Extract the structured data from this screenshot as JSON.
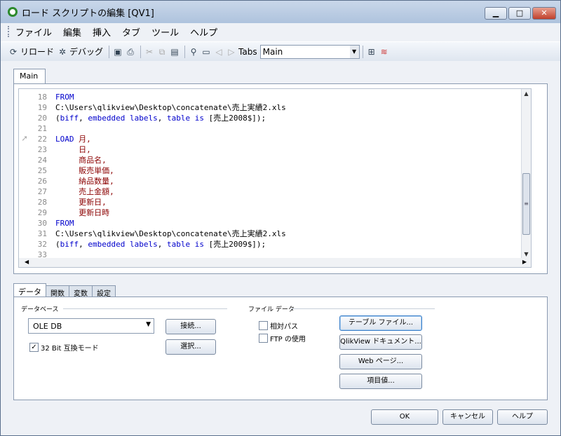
{
  "window": {
    "title": "ロード スクリプトの編集 [QV1]",
    "minimize": "▁",
    "maximize": "□",
    "close": "✕"
  },
  "menu": [
    "ファイル",
    "編集",
    "挿入",
    "タブ",
    "ツール",
    "ヘルプ"
  ],
  "toolbar": {
    "reload_label": "リロード",
    "debug_label": "デバッグ",
    "tabs_label": "Tabs",
    "tabs_selected": "Main",
    "icons": [
      "save-icon",
      "print-icon",
      "cut-icon",
      "copy-icon",
      "paste-icon",
      "search-icon",
      "folder-icon",
      "tab-left-icon",
      "tab-right-icon",
      "hierarchy-icon",
      "spellcheck-icon"
    ]
  },
  "editor": {
    "tab_label": "Main",
    "lines": [
      {
        "n": "18",
        "parts": [
          {
            "t": "FROM",
            "c": "kw"
          }
        ]
      },
      {
        "n": "19",
        "parts": [
          {
            "t": "C:\\Users\\qlikview\\Desktop\\concatenate\\売上実績2.xls",
            "c": ""
          }
        ]
      },
      {
        "n": "20",
        "parts": [
          {
            "t": "(",
            "c": ""
          },
          {
            "t": "biff",
            "c": "kw"
          },
          {
            "t": ", ",
            "c": ""
          },
          {
            "t": "embedded labels",
            "c": "kw"
          },
          {
            "t": ", ",
            "c": ""
          },
          {
            "t": "table is",
            "c": "kw"
          },
          {
            "t": " [売上2008$]);",
            "c": ""
          }
        ]
      },
      {
        "n": "21",
        "parts": []
      },
      {
        "n": "22",
        "parts": [
          {
            "t": "LOAD",
            "c": "kw"
          },
          {
            "t": " 月,",
            "c": "fd"
          }
        ],
        "marker": true
      },
      {
        "n": "23",
        "parts": [
          {
            "t": "     日,",
            "c": "fd"
          }
        ]
      },
      {
        "n": "24",
        "parts": [
          {
            "t": "     商品名,",
            "c": "fd"
          }
        ]
      },
      {
        "n": "25",
        "parts": [
          {
            "t": "     販売単価,",
            "c": "fd"
          }
        ]
      },
      {
        "n": "26",
        "parts": [
          {
            "t": "     納品数量,",
            "c": "fd"
          }
        ]
      },
      {
        "n": "27",
        "parts": [
          {
            "t": "     売上金額,",
            "c": "fd"
          }
        ]
      },
      {
        "n": "28",
        "parts": [
          {
            "t": "     更新日,",
            "c": "fd"
          }
        ]
      },
      {
        "n": "29",
        "parts": [
          {
            "t": "     更新日時",
            "c": "fd"
          }
        ]
      },
      {
        "n": "30",
        "parts": [
          {
            "t": "FROM",
            "c": "kw"
          }
        ]
      },
      {
        "n": "31",
        "parts": [
          {
            "t": "C:\\Users\\qlikview\\Desktop\\concatenate\\売上実績2.xls",
            "c": ""
          }
        ]
      },
      {
        "n": "32",
        "parts": [
          {
            "t": "(",
            "c": ""
          },
          {
            "t": "biff",
            "c": "kw"
          },
          {
            "t": ", ",
            "c": ""
          },
          {
            "t": "embedded labels",
            "c": "kw"
          },
          {
            "t": ", ",
            "c": ""
          },
          {
            "t": "table is",
            "c": "kw"
          },
          {
            "t": " [売上2009$]);",
            "c": ""
          }
        ]
      },
      {
        "n": "33",
        "parts": []
      }
    ]
  },
  "bottom_tabs": [
    "データ",
    "関数",
    "変数",
    "設定"
  ],
  "data_panel": {
    "database_group": "データベース",
    "database_selected": "OLE DB",
    "connect_btn": "接続...",
    "select_btn": "選択...",
    "compat32_label": "32 Bit 互換モード",
    "compat32_checked": true,
    "file_data_group": "ファイル データ",
    "relative_path_label": "相対パス",
    "ftp_label": "FTP の使用",
    "table_file_btn": "テーブル ファイル...",
    "qv_doc_btn": "QlikView ドキュメント...",
    "web_page_btn": "Web ページ...",
    "field_value_btn": "項目値..."
  },
  "dialog_buttons": {
    "ok": "OK",
    "cancel": "キャンセル",
    "help": "ヘルプ"
  }
}
